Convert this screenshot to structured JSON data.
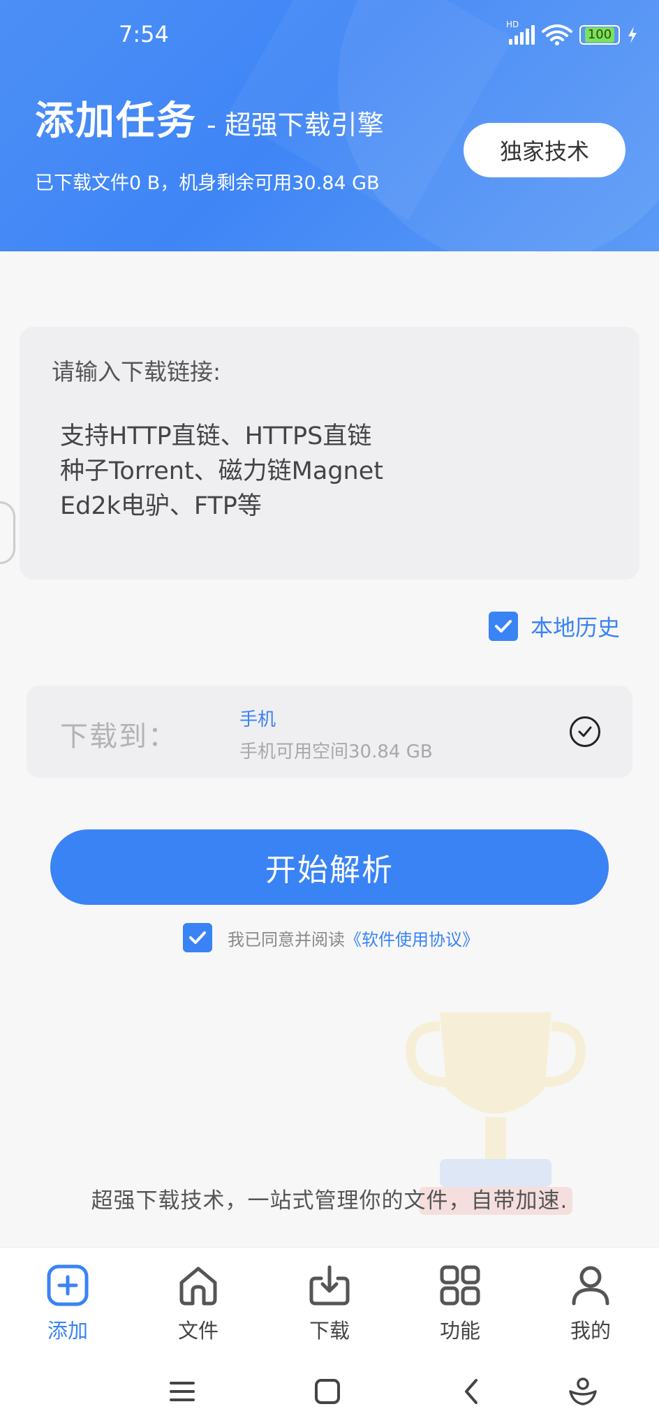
{
  "status_bar": {
    "time": "7:54",
    "network_badge": "HD",
    "battery": "100",
    "icons": [
      "signal-icon",
      "wifi-icon",
      "battery-icon",
      "charging-icon"
    ]
  },
  "header": {
    "title": "添加任务",
    "subtitle": "- 超强下载引擎",
    "storage_info": "已下载文件0 B，机身剩余可用30.84 GB",
    "tech_button": "独家技术"
  },
  "input": {
    "label": "请输入下载链接:",
    "hint": "支持HTTP直链、HTTPS直链\n种子Torrent、磁力链Magnet\nEd2k电驴、FTP等"
  },
  "history": {
    "label": "本地历史",
    "checked": true
  },
  "destination": {
    "label": "下载到：",
    "name": "手机",
    "space": "手机可用空间30.84 GB"
  },
  "actions": {
    "start_button": "开始解析"
  },
  "agreement": {
    "checked": true,
    "text": "我已同意并阅读",
    "link": "《软件使用协议》"
  },
  "tagline": "超强下载技术，一站式管理你的文件，自带加速.",
  "tabs": [
    {
      "label": "添加",
      "icon": "add-icon",
      "active": true
    },
    {
      "label": "文件",
      "icon": "home-icon",
      "active": false
    },
    {
      "label": "下载",
      "icon": "download-icon",
      "active": false
    },
    {
      "label": "功能",
      "icon": "grid-icon",
      "active": false
    },
    {
      "label": "我的",
      "icon": "person-icon",
      "active": false
    }
  ],
  "colors": {
    "accent": "#3a83f5",
    "header_bg": "#4c8ff5",
    "background": "#f7f7f7"
  }
}
